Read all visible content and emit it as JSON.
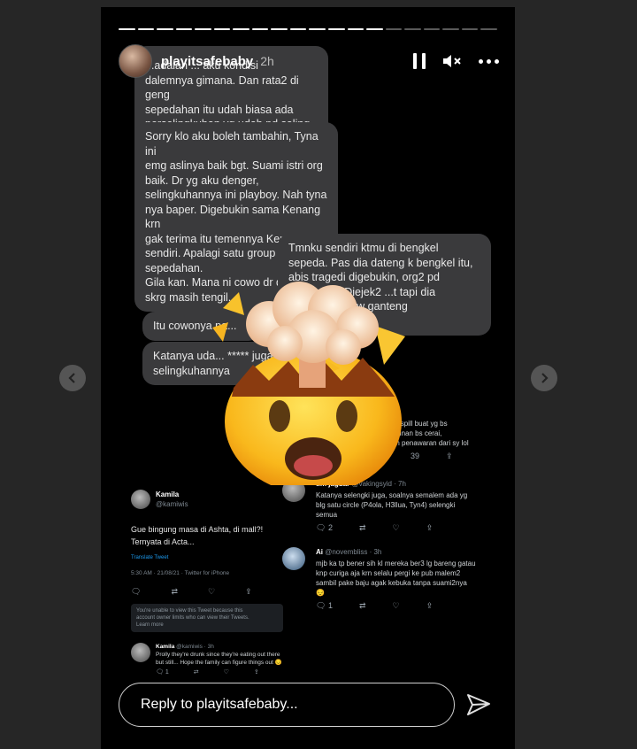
{
  "story": {
    "username": "playitsafebaby",
    "age": "2h",
    "progress_segments": 20,
    "progress_completed": 14
  },
  "messages": [
    "...adalah ... aku kondisi\ndalemnya gimana. Dan rata2 di geng\nsepedahan itu udah biasa ada\nperselingkuhan yg udah pd saling tau",
    "Sorry klo aku boleh tambahin, Tyna ini\nemg aslinya baik bgt. Suami istri org\nbaik. Dr yg aku denger,\nselingkuhannya ini playboy. Nah tyna\nnya baper. Digebukin sama Kenang krn\ngak terima itu temennya Kenang\nsendiri. Apalagi satu group sepedahan.\nGila kan. Mana ni cowo dr dulu smp\nskrg masih tengil.",
    "Tmnku sendiri ktmu di bengkel\nsepeda. Pas dia dateng k bengkel itu,\nabis tragedi digebukin, org2 pd\n...waln dia. Diejek2 ...t tapi dia\n...aya iyalah gw ganteng\n...da rasa guilty",
    "Itu cowonya pa...",
    "Katanya uda... ***** juga si t...\nselingkuhannya"
  ],
  "tweets": {
    "kamila": {
      "name": "Kamila",
      "handle": "@kamiwis",
      "text": "Gue bingung masa di Ashta, di mall?!\nTernyata di Acta...",
      "translate": "Translate Tweet",
      "meta": "5:30 AM · 21/08/21 · Twitter for iPhone",
      "notice": "You're unable to view this Tweet because this\naccount owner limits who can view their Tweets.\nLearn more",
      "reply_name": "Kamila",
      "reply_handle": "@kamiwis · 3h",
      "reply_text": "Prolly they're drunk since they're eating out there\nbut still... Hope the family can figure things out 😔",
      "reply_counts": [
        "1",
        "",
        "",
        ""
      ]
    },
    "top": {
      "text": "Gue bakal spill buat yg bs\n...olatambunan bs cerai,\n...? Sekian penawaran dari sy lol",
      "counts": [
        "12",
        "39"
      ]
    },
    "timjaguar": {
      "name": "tim jaguar",
      "handle": "@vakingsyid · 7h",
      "text": "Katanya selengki juga, soalnya semalem ada yg\nblg satu circle (P4ola, H3llua, Tyn4) selengki\nsemua",
      "counts": [
        "2",
        "",
        "",
        ""
      ]
    },
    "ai": {
      "name": "Ai",
      "handle": "@novembliss · 3h",
      "text": "mjb ka tp bener sih kl mereka ber3 lg bareng gatau\nknp curiga aja krn selalu pergi ke pub malem2\nsambil pake baju agak kebuka tanpa suami2nya\n😔",
      "counts": [
        "1",
        "",
        "",
        ""
      ]
    }
  },
  "reply_placeholder": "Reply to playitsafebaby...",
  "icons": [
    "pause-icon",
    "mute-icon",
    "more-icon",
    "send-icon",
    "chevron-left-icon",
    "chevron-right-icon",
    "exploding-head-emoji"
  ]
}
